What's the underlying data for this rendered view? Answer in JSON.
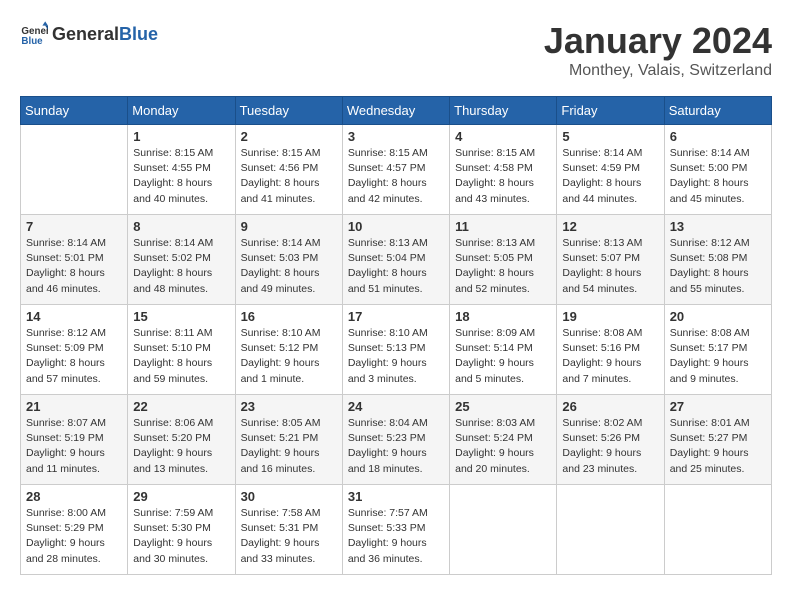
{
  "header": {
    "logo_general": "General",
    "logo_blue": "Blue",
    "month_title": "January 2024",
    "location": "Monthey, Valais, Switzerland"
  },
  "weekdays": [
    "Sunday",
    "Monday",
    "Tuesday",
    "Wednesday",
    "Thursday",
    "Friday",
    "Saturday"
  ],
  "weeks": [
    [
      {
        "day": "",
        "info": ""
      },
      {
        "day": "1",
        "info": "Sunrise: 8:15 AM\nSunset: 4:55 PM\nDaylight: 8 hours\nand 40 minutes."
      },
      {
        "day": "2",
        "info": "Sunrise: 8:15 AM\nSunset: 4:56 PM\nDaylight: 8 hours\nand 41 minutes."
      },
      {
        "day": "3",
        "info": "Sunrise: 8:15 AM\nSunset: 4:57 PM\nDaylight: 8 hours\nand 42 minutes."
      },
      {
        "day": "4",
        "info": "Sunrise: 8:15 AM\nSunset: 4:58 PM\nDaylight: 8 hours\nand 43 minutes."
      },
      {
        "day": "5",
        "info": "Sunrise: 8:14 AM\nSunset: 4:59 PM\nDaylight: 8 hours\nand 44 minutes."
      },
      {
        "day": "6",
        "info": "Sunrise: 8:14 AM\nSunset: 5:00 PM\nDaylight: 8 hours\nand 45 minutes."
      }
    ],
    [
      {
        "day": "7",
        "info": "Sunrise: 8:14 AM\nSunset: 5:01 PM\nDaylight: 8 hours\nand 46 minutes."
      },
      {
        "day": "8",
        "info": "Sunrise: 8:14 AM\nSunset: 5:02 PM\nDaylight: 8 hours\nand 48 minutes."
      },
      {
        "day": "9",
        "info": "Sunrise: 8:14 AM\nSunset: 5:03 PM\nDaylight: 8 hours\nand 49 minutes."
      },
      {
        "day": "10",
        "info": "Sunrise: 8:13 AM\nSunset: 5:04 PM\nDaylight: 8 hours\nand 51 minutes."
      },
      {
        "day": "11",
        "info": "Sunrise: 8:13 AM\nSunset: 5:05 PM\nDaylight: 8 hours\nand 52 minutes."
      },
      {
        "day": "12",
        "info": "Sunrise: 8:13 AM\nSunset: 5:07 PM\nDaylight: 8 hours\nand 54 minutes."
      },
      {
        "day": "13",
        "info": "Sunrise: 8:12 AM\nSunset: 5:08 PM\nDaylight: 8 hours\nand 55 minutes."
      }
    ],
    [
      {
        "day": "14",
        "info": "Sunrise: 8:12 AM\nSunset: 5:09 PM\nDaylight: 8 hours\nand 57 minutes."
      },
      {
        "day": "15",
        "info": "Sunrise: 8:11 AM\nSunset: 5:10 PM\nDaylight: 8 hours\nand 59 minutes."
      },
      {
        "day": "16",
        "info": "Sunrise: 8:10 AM\nSunset: 5:12 PM\nDaylight: 9 hours\nand 1 minute."
      },
      {
        "day": "17",
        "info": "Sunrise: 8:10 AM\nSunset: 5:13 PM\nDaylight: 9 hours\nand 3 minutes."
      },
      {
        "day": "18",
        "info": "Sunrise: 8:09 AM\nSunset: 5:14 PM\nDaylight: 9 hours\nand 5 minutes."
      },
      {
        "day": "19",
        "info": "Sunrise: 8:08 AM\nSunset: 5:16 PM\nDaylight: 9 hours\nand 7 minutes."
      },
      {
        "day": "20",
        "info": "Sunrise: 8:08 AM\nSunset: 5:17 PM\nDaylight: 9 hours\nand 9 minutes."
      }
    ],
    [
      {
        "day": "21",
        "info": "Sunrise: 8:07 AM\nSunset: 5:19 PM\nDaylight: 9 hours\nand 11 minutes."
      },
      {
        "day": "22",
        "info": "Sunrise: 8:06 AM\nSunset: 5:20 PM\nDaylight: 9 hours\nand 13 minutes."
      },
      {
        "day": "23",
        "info": "Sunrise: 8:05 AM\nSunset: 5:21 PM\nDaylight: 9 hours\nand 16 minutes."
      },
      {
        "day": "24",
        "info": "Sunrise: 8:04 AM\nSunset: 5:23 PM\nDaylight: 9 hours\nand 18 minutes."
      },
      {
        "day": "25",
        "info": "Sunrise: 8:03 AM\nSunset: 5:24 PM\nDaylight: 9 hours\nand 20 minutes."
      },
      {
        "day": "26",
        "info": "Sunrise: 8:02 AM\nSunset: 5:26 PM\nDaylight: 9 hours\nand 23 minutes."
      },
      {
        "day": "27",
        "info": "Sunrise: 8:01 AM\nSunset: 5:27 PM\nDaylight: 9 hours\nand 25 minutes."
      }
    ],
    [
      {
        "day": "28",
        "info": "Sunrise: 8:00 AM\nSunset: 5:29 PM\nDaylight: 9 hours\nand 28 minutes."
      },
      {
        "day": "29",
        "info": "Sunrise: 7:59 AM\nSunset: 5:30 PM\nDaylight: 9 hours\nand 30 minutes."
      },
      {
        "day": "30",
        "info": "Sunrise: 7:58 AM\nSunset: 5:31 PM\nDaylight: 9 hours\nand 33 minutes."
      },
      {
        "day": "31",
        "info": "Sunrise: 7:57 AM\nSunset: 5:33 PM\nDaylight: 9 hours\nand 36 minutes."
      },
      {
        "day": "",
        "info": ""
      },
      {
        "day": "",
        "info": ""
      },
      {
        "day": "",
        "info": ""
      }
    ]
  ]
}
